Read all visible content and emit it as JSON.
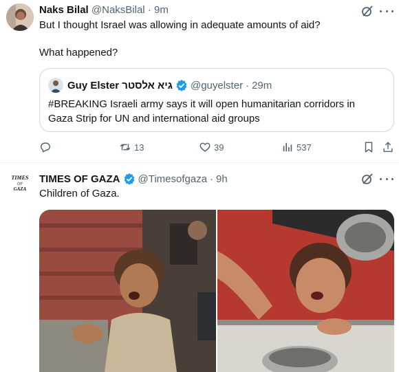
{
  "tweet1": {
    "display_name": "Naks Bilal",
    "handle": "@NaksBilal",
    "separator": "·",
    "time": "9m",
    "text_line1": "But I thought Israel was allowing in adequate amounts of aid?",
    "text_line2": "What happened?",
    "quote": {
      "display_name": "Guy Elster גיא אלסטר",
      "verified": true,
      "handle": "@guyelster",
      "separator": "·",
      "time": "29m",
      "text_line1": "#BREAKING Israeli army says it will open humanitarian corridors in",
      "text_line2": "Gaza Strip for UN and international aid groups"
    },
    "actions": {
      "reply_icon": "reply-icon",
      "retweet_count": "13",
      "like_count": "39",
      "views_count": "537"
    }
  },
  "tweet2": {
    "display_name": "TIMES OF GAZA",
    "verified": true,
    "handle": "@Timesofgaza",
    "separator": "·",
    "time": "9h",
    "text": "Children of Gaza.",
    "avatar_logo_text": "TIMES OF GAZA"
  },
  "colors": {
    "text": "#0f1419",
    "muted": "#536471",
    "verified": "#1d9bf0",
    "border": "#cfd9de"
  }
}
